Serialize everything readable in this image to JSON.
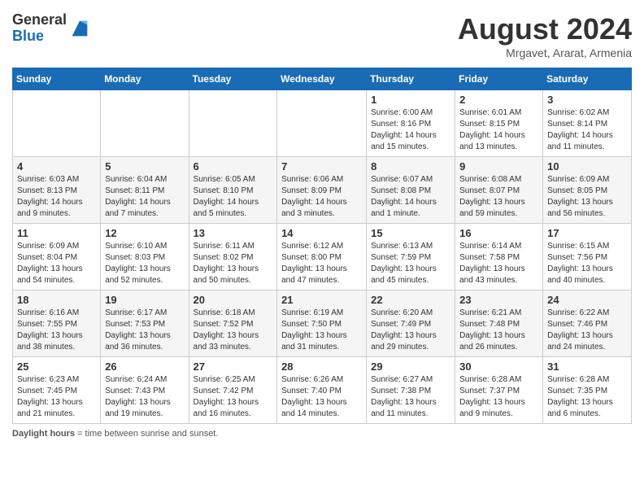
{
  "header": {
    "logo_line1": "General",
    "logo_line2": "Blue",
    "month_title": "August 2024",
    "subtitle": "Mrgavet, Ararat, Armenia"
  },
  "days_of_week": [
    "Sunday",
    "Monday",
    "Tuesday",
    "Wednesday",
    "Thursday",
    "Friday",
    "Saturday"
  ],
  "weeks": [
    [
      {
        "day": "",
        "info": ""
      },
      {
        "day": "",
        "info": ""
      },
      {
        "day": "",
        "info": ""
      },
      {
        "day": "",
        "info": ""
      },
      {
        "day": "1",
        "info": "Sunrise: 6:00 AM\nSunset: 8:16 PM\nDaylight: 14 hours and 15 minutes."
      },
      {
        "day": "2",
        "info": "Sunrise: 6:01 AM\nSunset: 8:15 PM\nDaylight: 14 hours and 13 minutes."
      },
      {
        "day": "3",
        "info": "Sunrise: 6:02 AM\nSunset: 8:14 PM\nDaylight: 14 hours and 11 minutes."
      }
    ],
    [
      {
        "day": "4",
        "info": "Sunrise: 6:03 AM\nSunset: 8:13 PM\nDaylight: 14 hours and 9 minutes."
      },
      {
        "day": "5",
        "info": "Sunrise: 6:04 AM\nSunset: 8:11 PM\nDaylight: 14 hours and 7 minutes."
      },
      {
        "day": "6",
        "info": "Sunrise: 6:05 AM\nSunset: 8:10 PM\nDaylight: 14 hours and 5 minutes."
      },
      {
        "day": "7",
        "info": "Sunrise: 6:06 AM\nSunset: 8:09 PM\nDaylight: 14 hours and 3 minutes."
      },
      {
        "day": "8",
        "info": "Sunrise: 6:07 AM\nSunset: 8:08 PM\nDaylight: 14 hours and 1 minute."
      },
      {
        "day": "9",
        "info": "Sunrise: 6:08 AM\nSunset: 8:07 PM\nDaylight: 13 hours and 59 minutes."
      },
      {
        "day": "10",
        "info": "Sunrise: 6:09 AM\nSunset: 8:05 PM\nDaylight: 13 hours and 56 minutes."
      }
    ],
    [
      {
        "day": "11",
        "info": "Sunrise: 6:09 AM\nSunset: 8:04 PM\nDaylight: 13 hours and 54 minutes."
      },
      {
        "day": "12",
        "info": "Sunrise: 6:10 AM\nSunset: 8:03 PM\nDaylight: 13 hours and 52 minutes."
      },
      {
        "day": "13",
        "info": "Sunrise: 6:11 AM\nSunset: 8:02 PM\nDaylight: 13 hours and 50 minutes."
      },
      {
        "day": "14",
        "info": "Sunrise: 6:12 AM\nSunset: 8:00 PM\nDaylight: 13 hours and 47 minutes."
      },
      {
        "day": "15",
        "info": "Sunrise: 6:13 AM\nSunset: 7:59 PM\nDaylight: 13 hours and 45 minutes."
      },
      {
        "day": "16",
        "info": "Sunrise: 6:14 AM\nSunset: 7:58 PM\nDaylight: 13 hours and 43 minutes."
      },
      {
        "day": "17",
        "info": "Sunrise: 6:15 AM\nSunset: 7:56 PM\nDaylight: 13 hours and 40 minutes."
      }
    ],
    [
      {
        "day": "18",
        "info": "Sunrise: 6:16 AM\nSunset: 7:55 PM\nDaylight: 13 hours and 38 minutes."
      },
      {
        "day": "19",
        "info": "Sunrise: 6:17 AM\nSunset: 7:53 PM\nDaylight: 13 hours and 36 minutes."
      },
      {
        "day": "20",
        "info": "Sunrise: 6:18 AM\nSunset: 7:52 PM\nDaylight: 13 hours and 33 minutes."
      },
      {
        "day": "21",
        "info": "Sunrise: 6:19 AM\nSunset: 7:50 PM\nDaylight: 13 hours and 31 minutes."
      },
      {
        "day": "22",
        "info": "Sunrise: 6:20 AM\nSunset: 7:49 PM\nDaylight: 13 hours and 29 minutes."
      },
      {
        "day": "23",
        "info": "Sunrise: 6:21 AM\nSunset: 7:48 PM\nDaylight: 13 hours and 26 minutes."
      },
      {
        "day": "24",
        "info": "Sunrise: 6:22 AM\nSunset: 7:46 PM\nDaylight: 13 hours and 24 minutes."
      }
    ],
    [
      {
        "day": "25",
        "info": "Sunrise: 6:23 AM\nSunset: 7:45 PM\nDaylight: 13 hours and 21 minutes."
      },
      {
        "day": "26",
        "info": "Sunrise: 6:24 AM\nSunset: 7:43 PM\nDaylight: 13 hours and 19 minutes."
      },
      {
        "day": "27",
        "info": "Sunrise: 6:25 AM\nSunset: 7:42 PM\nDaylight: 13 hours and 16 minutes."
      },
      {
        "day": "28",
        "info": "Sunrise: 6:26 AM\nSunset: 7:40 PM\nDaylight: 13 hours and 14 minutes."
      },
      {
        "day": "29",
        "info": "Sunrise: 6:27 AM\nSunset: 7:38 PM\nDaylight: 13 hours and 11 minutes."
      },
      {
        "day": "30",
        "info": "Sunrise: 6:28 AM\nSunset: 7:37 PM\nDaylight: 13 hours and 9 minutes."
      },
      {
        "day": "31",
        "info": "Sunrise: 6:28 AM\nSunset: 7:35 PM\nDaylight: 13 hours and 6 minutes."
      }
    ]
  ],
  "footer": {
    "label": "Daylight hours"
  }
}
